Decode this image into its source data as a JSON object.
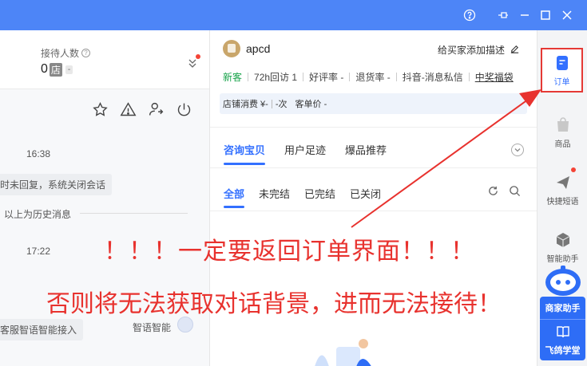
{
  "colors": {
    "titlebar": "#4d85f7",
    "accent": "#3370ff",
    "annotation": "#e8322e",
    "green": "#17a34a"
  },
  "left": {
    "recv_label": "接待人数",
    "recv_value": "0",
    "recv_unit": "店",
    "recv_dash": "-",
    "time1": "16:38",
    "sys_msg1": "时未回复，系统关闭会话",
    "history": "以上为历史消息",
    "time2": "17:22",
    "sys_msg2": "客服智语智能接入",
    "bot_name": "智语智能"
  },
  "customer": {
    "username": "apcd",
    "add_desc": "给买家添加描述",
    "stats": {
      "new": "新客",
      "visits": "72h回访 1",
      "good_rate": "好评率 -",
      "refund_rate": "退货率 -",
      "douyin": "抖音-消息私信",
      "prize": "中奖福袋"
    },
    "consume": {
      "label": "店铺消费 ¥-",
      "times": "-次",
      "avg": "客单价 -"
    }
  },
  "tabs_main": [
    "咨询宝贝",
    "用户足迹",
    "爆品推荐"
  ],
  "tabs_order": [
    "全部",
    "未完结",
    "已完结",
    "已关闭"
  ],
  "sidebar": {
    "order": "订单",
    "goods": "商品",
    "quick_reply": "快捷短语",
    "assistant": "智能助手",
    "merchant": "商家助手",
    "school": "飞鸽学堂"
  },
  "annotation": {
    "line1": "！！！一定要返回订单界面！！！",
    "line2": "否则将无法获取对话背景，进而无法接待！"
  }
}
